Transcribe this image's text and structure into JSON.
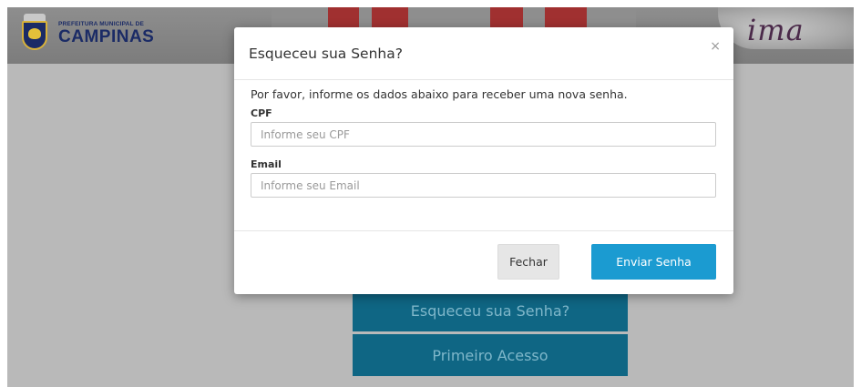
{
  "header": {
    "brand_small": "PREFEITURA MUNICIPAL DE",
    "brand_name": "CAMPINAS",
    "logo_right": "ima"
  },
  "background": {
    "forgot_button": "Esqueceu sua Senha?",
    "first_access_button": "Primeiro Acesso"
  },
  "modal": {
    "title": "Esqueceu sua Senha?",
    "close_symbol": "×",
    "intro": "Por favor, informe os dados abaixo para receber uma nova senha.",
    "cpf_label": "CPF",
    "cpf_placeholder": "Informe seu CPF",
    "email_label": "Email",
    "email_placeholder": "Informe seu Email",
    "close_button": "Fechar",
    "submit_button": "Enviar Senha"
  },
  "colors": {
    "overlay_background": "#b9b9b9",
    "primary_button": "#1b9bd1",
    "background_button": "#0f6684",
    "brand_navy": "#1b2b66"
  }
}
